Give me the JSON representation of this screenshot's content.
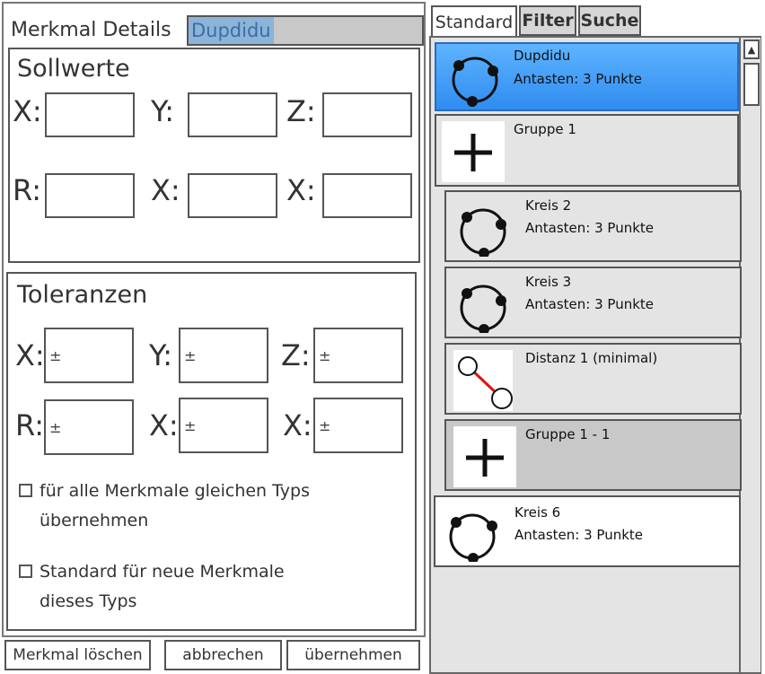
{
  "details": {
    "title": "Merkmal Details",
    "name": "Dupdidu"
  },
  "sollwerte": {
    "title": "Sollwerte",
    "labels": [
      "X:",
      "Y:",
      "Z:",
      "R:",
      "X:",
      "X:"
    ]
  },
  "toleranzen": {
    "title": "Toleranzen",
    "labels": [
      "X:",
      "Y:",
      "Z:",
      "R:",
      "X:",
      "X:"
    ],
    "prefix": "±"
  },
  "checkboxes": [
    {
      "label": "für alle Merkmale gleichen Typs übernehmen",
      "checked": false
    },
    {
      "label": "Standard für neue Merkmale dieses Typs",
      "checked": false
    }
  ],
  "buttons": {
    "delete": "Merkmal löschen",
    "cancel": "abbrechen",
    "apply": "übernehmen"
  },
  "tabs": [
    {
      "label": "Standard",
      "active": true
    },
    {
      "label": "Filter",
      "active": false
    },
    {
      "label": "Suche",
      "active": false
    }
  ],
  "list": [
    {
      "name": "Dupdidu",
      "detail": "Antasten: 3 Punkte",
      "icon": "circle-3-points-icon",
      "state": "selected"
    },
    {
      "name": "Gruppe 1",
      "detail": "",
      "icon": "plus-icon",
      "state": "normal"
    },
    {
      "name": "Kreis 2",
      "detail": "Antasten: 3 Punkte",
      "icon": "circle-3-points-icon",
      "state": "normal"
    },
    {
      "name": "Kreis 3",
      "detail": "Antasten: 3 Punkte",
      "icon": "circle-3-points-icon",
      "state": "normal"
    },
    {
      "name": "Distanz 1 (minimal)",
      "detail": "",
      "icon": "distance-icon",
      "state": "normal"
    },
    {
      "name": "Gruppe 1 - 1",
      "detail": "",
      "icon": "plus-icon",
      "state": "dark"
    },
    {
      "name": "Kreis 6",
      "detail": "Antasten: 3 Punkte",
      "icon": "circle-3-points-icon",
      "state": "white"
    }
  ],
  "colors": {
    "selection": "#2f8cf0",
    "name_highlight": "#8cb4d8",
    "distance_line": "#dd1111"
  }
}
